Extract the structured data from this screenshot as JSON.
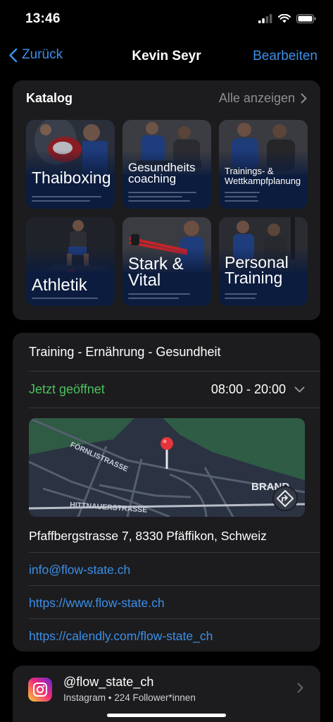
{
  "status_bar": {
    "time": "13:46"
  },
  "nav": {
    "back_label": "Zurück",
    "title": "Kevin Seyr",
    "edit_label": "Bearbeiten"
  },
  "catalog": {
    "title": "Katalog",
    "show_all": "Alle anzeigen",
    "items": [
      {
        "label": "Thaiboxing"
      },
      {
        "label": "Gesundheits coaching"
      },
      {
        "label": "Trainings- & Wettkampfplanung"
      },
      {
        "label": "Athletik"
      },
      {
        "label": "Stark & Vital"
      },
      {
        "label": "Personal Training"
      }
    ]
  },
  "business": {
    "tagline": "Training - Ernährung - Gesundheit",
    "open_status": "Jetzt geöffnet",
    "hours": "08:00 - 20:00",
    "map": {
      "street_1": "FÖRNLISTRASSE",
      "street_2": "HITTNAUERSTRASSE",
      "place": "BRAND"
    },
    "address": "Pfaffbergstrasse 7, 8330 Pfäffikon, Schweiz",
    "email": "info@flow-state.ch",
    "website": "https://www.flow-state.ch",
    "booking": "https://calendly.com/flow-state_ch"
  },
  "instagram": {
    "handle": "@flow_state_ch",
    "meta": "Instagram • 224 Follower*innen"
  },
  "colors": {
    "accent": "#3b8fe8",
    "open": "#4cc15c",
    "card": "#1c1c1e",
    "background": "#000000"
  }
}
